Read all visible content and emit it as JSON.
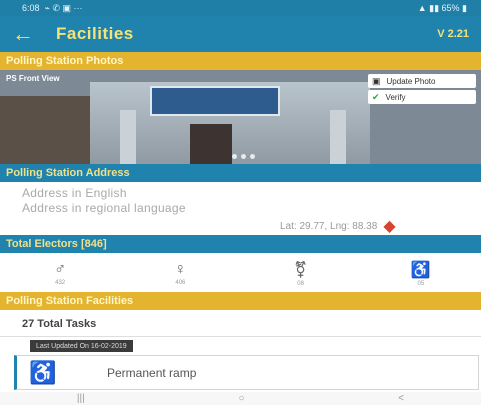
{
  "status_bar": {
    "time": "6:08",
    "left_icons": "⌁ ✆ ▣ ···",
    "right_info": "▲ ▮▮ 65% ▮"
  },
  "app_bar": {
    "back_icon": "←",
    "title": "Facilities",
    "version": "V 2.21"
  },
  "photos_section": {
    "title": "Polling Station Photos",
    "photo_label": "PS Front View",
    "update_label": "Update Photo",
    "verify_label": "Verify"
  },
  "address_section": {
    "title": "Polling Station Address",
    "address_english": "Address in English",
    "address_regional": "Address in regional language",
    "lat_lng": "Lat: 29.77, Lng: 88.38"
  },
  "electors_section": {
    "title": "Total Electors [846]",
    "items": [
      {
        "icon": "male-icon",
        "value": "432"
      },
      {
        "icon": "female-icon",
        "value": "406"
      },
      {
        "icon": "third-gender-icon",
        "value": "08"
      },
      {
        "icon": "pwd-icon",
        "value": "05"
      }
    ]
  },
  "facilities_section": {
    "title": "Polling Station Facilities",
    "total_tasks": "27 Total Tasks",
    "last_update": "Last Updated On 16-02-2019",
    "facility_item": "Permanent ramp"
  },
  "nav": {
    "recent": "|||",
    "home": "○",
    "back": "<"
  }
}
